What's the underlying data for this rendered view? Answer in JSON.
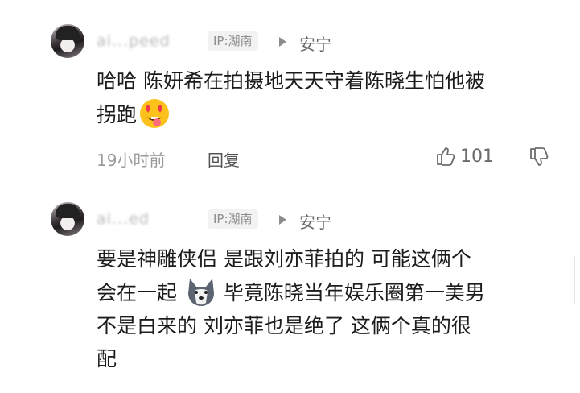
{
  "comments": [
    {
      "name": "ai...peed",
      "ip": "IP:湖南",
      "reply_to": "安宁",
      "lines": [
        "哈哈 陈妍希在拍摄地天天守着陈晓生怕他被",
        "拐跑"
      ],
      "time": "19小时前",
      "reply_label": "回复",
      "likes": "101"
    },
    {
      "name": "ai...ed",
      "ip": "IP:湖南",
      "reply_to": "安宁",
      "lines": [
        "要是神雕侠侣 是跟刘亦菲拍的 可能这俩个",
        "会在一起",
        "毕竟陈晓当年娱乐圈第一美男",
        "不是白来的 刘亦菲也是绝了 这俩个真的很",
        "配"
      ]
    }
  ],
  "icons": {
    "emoji1": "heart-eyes-tongue-emoji",
    "emoji2": "husky-dog-emoji",
    "like": "thumbs-up-icon",
    "dislike": "thumbs-down-icon",
    "reply_arrow": "triangle-right-icon"
  },
  "colors": {
    "meta": "#9a9a9a",
    "badge_bg": "#f2f2f2",
    "text": "#1c1c1c"
  }
}
